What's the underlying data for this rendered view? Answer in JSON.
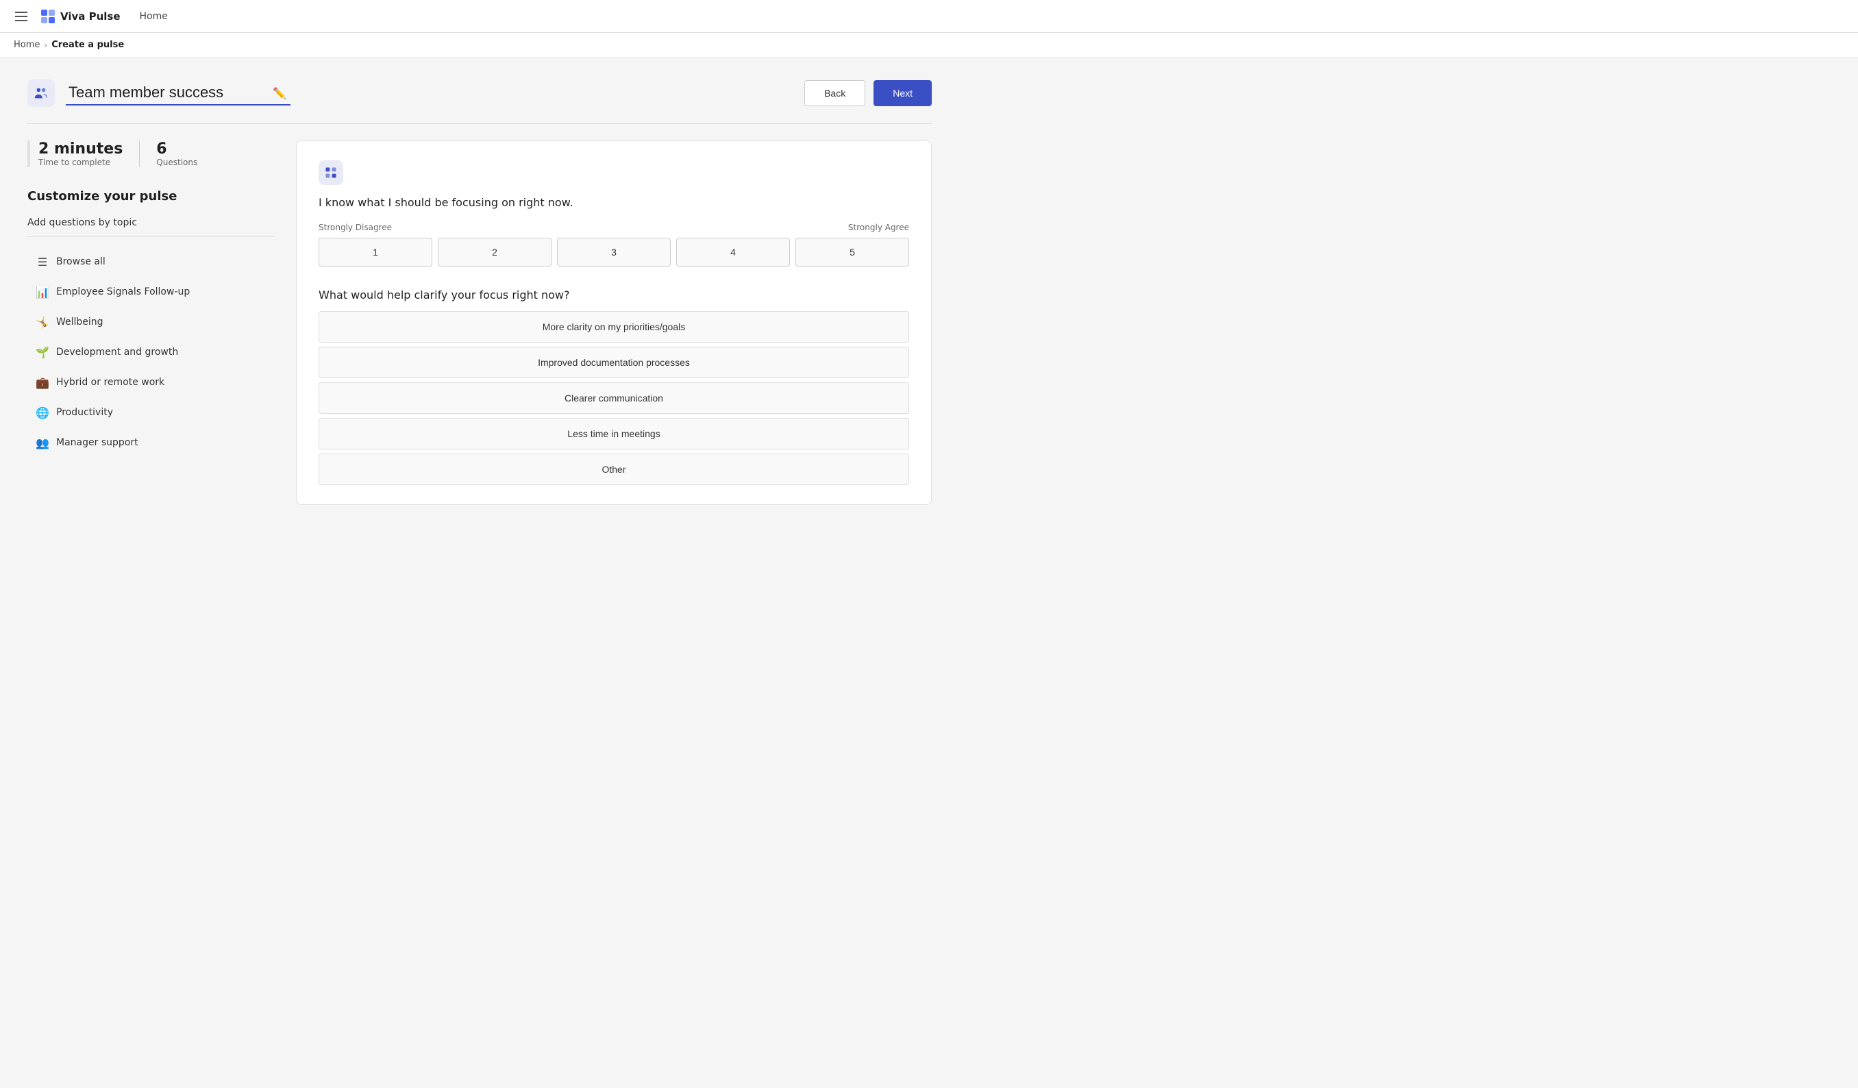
{
  "topnav": {
    "logo_text": "Viva Pulse",
    "home_label": "Home"
  },
  "breadcrumb": {
    "home_label": "Home",
    "separator": "›",
    "current_label": "Create a pulse"
  },
  "header": {
    "title_value": "Team member success",
    "back_label": "Back",
    "next_label": "Next"
  },
  "stats": {
    "time_value": "2 minutes",
    "time_label": "Time to complete",
    "questions_value": "6",
    "questions_label": "Questions"
  },
  "left_panel": {
    "customize_title": "Customize your pulse",
    "topic_section_label": "Add questions by topic",
    "topics": [
      {
        "icon": "☰",
        "label": "Browse all"
      },
      {
        "icon": "📊",
        "label": "Employee Signals Follow-up"
      },
      {
        "icon": "🤸",
        "label": "Wellbeing"
      },
      {
        "icon": "🌱",
        "label": "Development and growth"
      },
      {
        "icon": "💼",
        "label": "Hybrid or remote work"
      },
      {
        "icon": "🌐",
        "label": "Productivity"
      },
      {
        "icon": "👥",
        "label": "Manager support"
      }
    ]
  },
  "right_panel": {
    "question1_text": "I know what I should be focusing on right now.",
    "scale_low_label": "Strongly Disagree",
    "scale_high_label": "Strongly Agree",
    "scale_options": [
      "1",
      "2",
      "3",
      "4",
      "5"
    ],
    "question2_text": "What would help clarify your focus right now?",
    "choices": [
      "More clarity on my priorities/goals",
      "Improved documentation processes",
      "Clearer communication",
      "Less time in meetings",
      "Other"
    ]
  }
}
